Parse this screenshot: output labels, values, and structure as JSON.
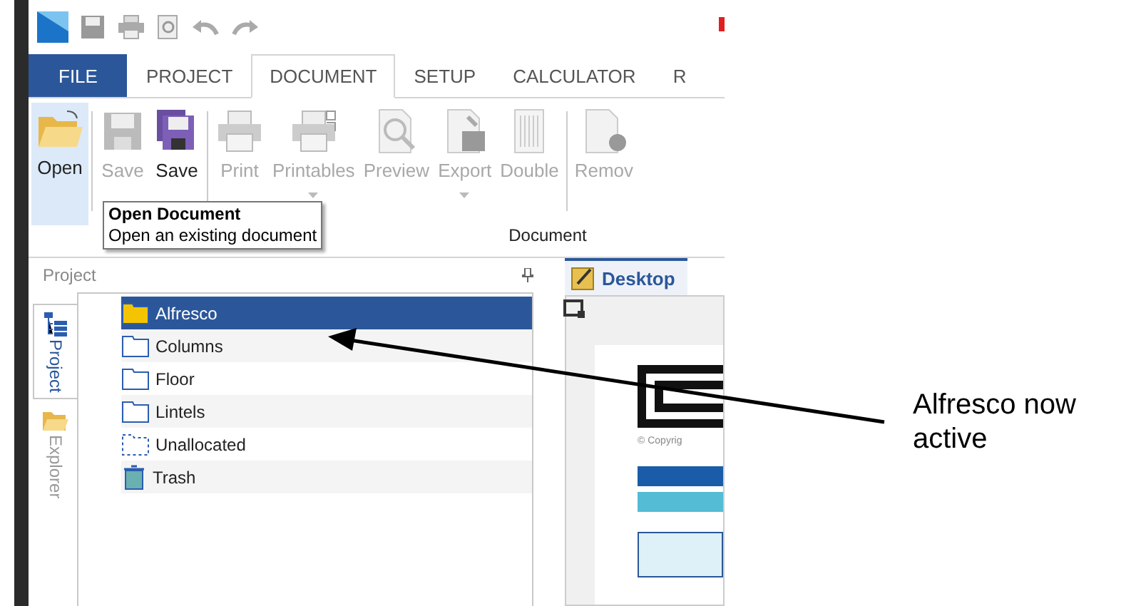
{
  "tabs": [
    {
      "label": "FILE",
      "kind": "file",
      "selected": false
    },
    {
      "label": "PROJECT",
      "kind": "tab",
      "selected": false
    },
    {
      "label": "DOCUMENT",
      "kind": "tab",
      "selected": true
    },
    {
      "label": "SETUP",
      "kind": "tab",
      "selected": false
    },
    {
      "label": "CALCULATOR",
      "kind": "tab",
      "selected": false
    },
    {
      "label": "R",
      "kind": "tab",
      "selected": false
    }
  ],
  "ribbon": {
    "buttons": [
      {
        "label": "Open",
        "kind": "open",
        "disabled": false,
        "selected": true,
        "dropdown": false
      },
      {
        "label": "Save",
        "kind": "save",
        "disabled": true,
        "selected": false,
        "dropdown": false
      },
      {
        "label": "Save",
        "kind": "saveall",
        "disabled": false,
        "selected": false,
        "dropdown": false
      },
      {
        "label": "Print",
        "kind": "print",
        "disabled": true,
        "selected": false,
        "dropdown": false
      },
      {
        "label": "Printables",
        "kind": "printables",
        "disabled": true,
        "selected": false,
        "dropdown": true
      },
      {
        "label": "Preview",
        "kind": "preview",
        "disabled": true,
        "selected": false,
        "dropdown": false
      },
      {
        "label": "Export",
        "kind": "export",
        "disabled": true,
        "selected": false,
        "dropdown": true
      },
      {
        "label": "Double",
        "kind": "double",
        "disabled": true,
        "selected": false,
        "dropdown": false
      },
      {
        "label": "Remov",
        "kind": "remove",
        "disabled": true,
        "selected": false,
        "dropdown": false
      }
    ],
    "group_label": "Document"
  },
  "tooltip": {
    "title": "Open Document",
    "description": "Open an existing document"
  },
  "panel": {
    "title": "Project",
    "side_tabs": [
      {
        "label": "Project",
        "kind": "project",
        "selected": true
      },
      {
        "label": "Explorer",
        "kind": "explorer",
        "selected": false
      }
    ],
    "tree": [
      {
        "label": "Alfresco",
        "kind": "folder",
        "selected": true
      },
      {
        "label": "Columns",
        "kind": "folder",
        "selected": false
      },
      {
        "label": "Floor",
        "kind": "folder",
        "selected": false
      },
      {
        "label": "Lintels",
        "kind": "folder",
        "selected": false
      },
      {
        "label": "Unallocated",
        "kind": "unallocated",
        "selected": false
      },
      {
        "label": "Trash",
        "kind": "trash",
        "selected": false
      }
    ]
  },
  "document": {
    "tab": "Desktop",
    "copyright": "© Copyrig"
  },
  "annotation": "Alfresco now active"
}
